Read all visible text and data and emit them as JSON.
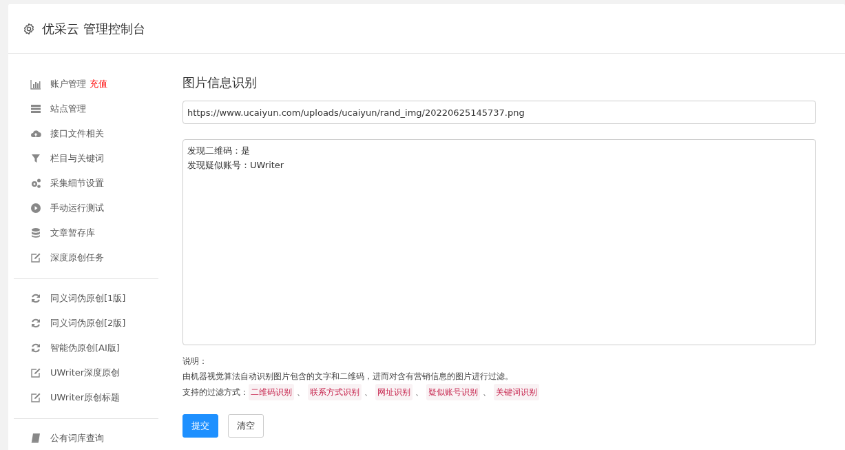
{
  "header": {
    "title": "优采云 管理控制台"
  },
  "sidebar": {
    "groups": [
      {
        "items": [
          {
            "label": "账户管理",
            "kind": "chart",
            "badge": "充值"
          },
          {
            "label": "站点管理",
            "kind": "server"
          },
          {
            "label": "接口文件相关",
            "kind": "cloud"
          },
          {
            "label": "栏目与关键词",
            "kind": "filter"
          },
          {
            "label": "采集细节设置",
            "kind": "gears"
          },
          {
            "label": "手动运行测试",
            "kind": "play"
          },
          {
            "label": "文章暂存库",
            "kind": "database"
          },
          {
            "label": "深度原创任务",
            "kind": "edit"
          }
        ]
      },
      {
        "items": [
          {
            "label": "同义词伪原创[1版]",
            "kind": "refresh"
          },
          {
            "label": "同义词伪原创[2版]",
            "kind": "refresh"
          },
          {
            "label": "智能伪原创[AI版]",
            "kind": "refresh"
          },
          {
            "label": "UWriter深度原创",
            "kind": "edit"
          },
          {
            "label": "UWriter原创标题",
            "kind": "edit"
          }
        ]
      },
      {
        "items": [
          {
            "label": "公有词库查询",
            "kind": "book"
          }
        ]
      }
    ]
  },
  "main": {
    "title": "图片信息识别",
    "url_field": {
      "value": "https://www.ucaiyun.com/uploads/ucaiyun/rand_img/20220625145737.png"
    },
    "result_box": {
      "lines": [
        "发现二维码：是",
        "发现疑似账号：UWriter"
      ]
    },
    "note_label": "说明：",
    "note_text": "由机器视觉算法自动识别图片包含的文字和二维码，进而对含有营销信息的图片进行过滤。",
    "methods_label": "支持的过滤方式：",
    "methods_separator": "、",
    "methods": [
      "二维码识别",
      "联系方式识别",
      "网址识别",
      "疑似账号识别",
      "关键词识别"
    ],
    "buttons": [
      {
        "label": "提交",
        "kind": "primary"
      },
      {
        "label": "清空",
        "kind": "default"
      }
    ]
  }
}
